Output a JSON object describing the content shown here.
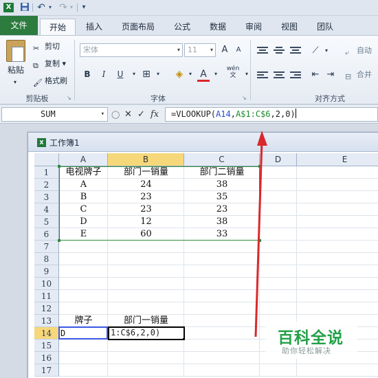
{
  "qat": {
    "logo": "X",
    "save_icon": "save-icon",
    "undo_label": "↶",
    "redo_label": "↷",
    "more_label": "▾"
  },
  "tabs": [
    "文件",
    "开始",
    "插入",
    "页面布局",
    "公式",
    "数据",
    "审阅",
    "视图",
    "团队"
  ],
  "ribbon": {
    "clipboard": {
      "paste": "粘贴",
      "cut": "剪切",
      "copy": "复制",
      "format_painter": "格式刷",
      "group": "剪贴板"
    },
    "font": {
      "font_name": "宋体",
      "font_size": "11",
      "bold": "B",
      "italic": "I",
      "underline": "U",
      "grow": "A",
      "shrink": "A",
      "color_a": "A",
      "wen": "wén",
      "group": "字体"
    },
    "alignment": {
      "wrap": "自动",
      "merge": "合并",
      "group": "对齐方式"
    }
  },
  "formula_bar": {
    "name_box": "SUM",
    "fx": "fx",
    "formula": {
      "prefix": "=VLOOKUP(",
      "ref1": "A14",
      "comma1": ",",
      "ref2": "A$1:C$6",
      "rest": ",2,0)"
    }
  },
  "workbook": {
    "title": "工作簿1",
    "columns": [
      "A",
      "B",
      "C",
      "D",
      "E"
    ],
    "rows": [
      "1",
      "2",
      "3",
      "4",
      "5",
      "6",
      "7",
      "8",
      "9",
      "10",
      "11",
      "12",
      "13",
      "14",
      "15",
      "16",
      "17"
    ],
    "table": [
      [
        "电视牌子",
        "部门一销量",
        "部门二销量"
      ],
      [
        "A",
        "24",
        "38"
      ],
      [
        "B",
        "23",
        "35"
      ],
      [
        "C",
        "23",
        "23"
      ],
      [
        "D",
        "12",
        "38"
      ],
      [
        "E",
        "60",
        "33"
      ]
    ],
    "lookup_headers": [
      "牌子",
      "部门一销量"
    ],
    "lookup_input": "D",
    "editing_text": "1:C$6,2,0)"
  },
  "watermark": {
    "title": "百科全说",
    "subtitle": "助你轻松解决"
  },
  "colors": {
    "file_tab": "#2c7b3f",
    "selected_header": "#f6d77a",
    "range_border": "#2f8a3f",
    "ref_blue": "#2749d6",
    "arrow_red": "#d9282c"
  }
}
